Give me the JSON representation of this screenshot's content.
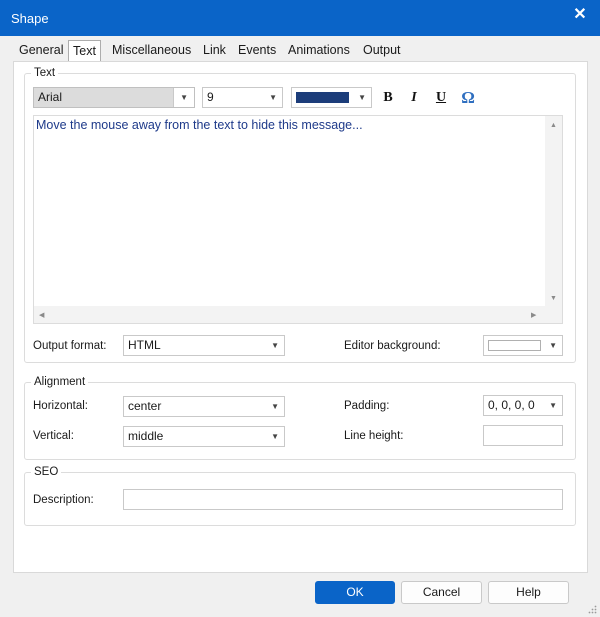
{
  "window": {
    "title": "Shape",
    "close_glyph": "✕"
  },
  "tabs": [
    {
      "label": "General"
    },
    {
      "label": "Text",
      "active": true
    },
    {
      "label": "Miscellaneous"
    },
    {
      "label": "Link"
    },
    {
      "label": "Events"
    },
    {
      "label": "Animations"
    },
    {
      "label": "Output"
    }
  ],
  "text_group": {
    "label": "Text",
    "font": "Arial",
    "size": "9",
    "color": "#1c3d7a",
    "bold": "B",
    "italic": "I",
    "underline": "U",
    "symbol": "Ω",
    "editor_content": "Move the mouse away from the text to hide this message...",
    "output_format_label": "Output format:",
    "output_format_value": "HTML",
    "editor_background_label": "Editor background:"
  },
  "alignment_group": {
    "label": "Alignment",
    "horizontal_label": "Horizontal:",
    "horizontal_value": "center",
    "vertical_label": "Vertical:",
    "vertical_value": "middle",
    "padding_label": "Padding:",
    "padding_value": "0, 0, 0, 0",
    "line_height_label": "Line height:",
    "line_height_value": ""
  },
  "seo_group": {
    "label": "SEO",
    "description_label": "Description:",
    "description_value": ""
  },
  "buttons": {
    "ok": "OK",
    "cancel": "Cancel",
    "help": "Help"
  },
  "icons": {
    "dropdown": "▼",
    "scroll_up": "▲",
    "scroll_down": "▼",
    "scroll_left": "◀",
    "scroll_right": "▶"
  }
}
